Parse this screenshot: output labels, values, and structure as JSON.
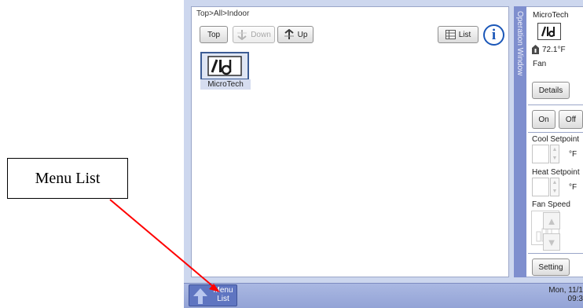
{
  "annotation": {
    "label": "Menu List"
  },
  "main": {
    "breadcrumb": "Top>All>Indoor",
    "toolbar": {
      "top_label": "Top",
      "down_label": "Down",
      "up_label": "Up",
      "list_label": "List"
    },
    "devices": [
      {
        "label": "MicroTech"
      }
    ]
  },
  "operation_tab": {
    "label": "Operation Window"
  },
  "control": {
    "device_name": "MicroTech",
    "temperature": "72.1°F",
    "mode": "Fan",
    "details_label": "Details",
    "on_label": "On",
    "off_label": "Off",
    "cool_setpoint_label": "Cool Setpoint",
    "cool_unit": "°F",
    "heat_setpoint_label": "Heat Setpoint",
    "heat_unit": "°F",
    "fan_speed_label": "Fan Speed",
    "setting_label": "Setting"
  },
  "bottom": {
    "menu_label": "Menu\nList",
    "datetime": "Mon, 11/1\n09:3"
  },
  "colors": {
    "accent": "#1b57b8",
    "tab": "#7f8fce",
    "bar": "#93a3d6",
    "annotation_arrow": "#ff0000"
  },
  "icons": [
    "up-arrow-icon",
    "down-arrow-icon",
    "list-icon",
    "info-icon",
    "microtech-logo-icon",
    "thermometer-icon",
    "fan-speed-icon",
    "menu-arrow-icon"
  ]
}
